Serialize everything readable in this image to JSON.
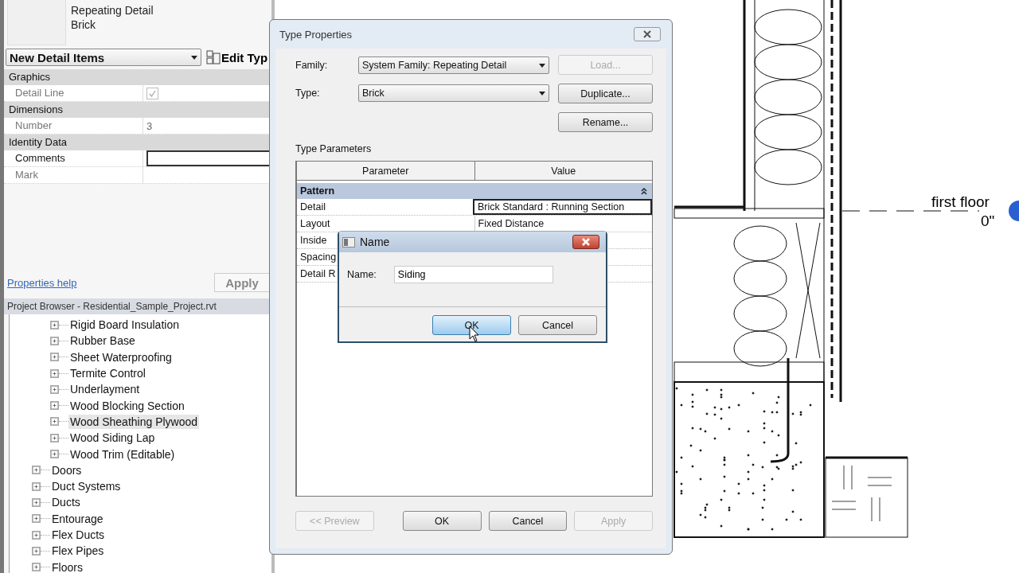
{
  "properties": {
    "type_name": [
      "Repeating Detail",
      "Brick"
    ],
    "selector": "New Detail Items",
    "edit_type": "Edit Typ",
    "groups": [
      {
        "name": "Graphics",
        "rows": [
          {
            "kind": "checkbox",
            "label": "Detail Line",
            "checked": true
          }
        ]
      },
      {
        "name": "Dimensions",
        "rows": [
          {
            "kind": "text",
            "label": "Number",
            "value": "3"
          }
        ]
      },
      {
        "name": "Identity Data",
        "rows": [
          {
            "kind": "field",
            "label": "Comments"
          },
          {
            "kind": "text",
            "label": "Mark"
          }
        ]
      }
    ],
    "help_link": "Properties help",
    "apply": {
      "label": "Apply",
      "disabled": true
    }
  },
  "browser": {
    "title": "Project Browser - Residential_Sample_Project.rvt",
    "tree": [
      {
        "children": [
          {
            "label": "Rigid Board Insulation",
            "selected": false
          },
          {
            "label": "Rubber Base",
            "selected": false
          },
          {
            "label": "Sheet Waterproofing",
            "selected": false
          },
          {
            "label": "Termite Control",
            "selected": false
          },
          {
            "label": "Underlayment",
            "selected": false
          },
          {
            "label": "Wood Blocking Section",
            "selected": false
          },
          {
            "label": "Wood Sheathing Plywood",
            "selected": true
          },
          {
            "label": "Wood Siding Lap",
            "selected": false
          },
          {
            "label": "Wood Trim (Editable)",
            "selected": false
          }
        ]
      },
      {
        "label": "Doors",
        "selected": false
      },
      {
        "label": "Duct Systems",
        "selected": false
      },
      {
        "label": "Ducts",
        "selected": false
      },
      {
        "label": "Entourage",
        "selected": false
      },
      {
        "label": "Flex Ducts",
        "selected": false
      },
      {
        "label": "Flex Pipes",
        "selected": false
      },
      {
        "label": "Floors",
        "selected": false
      }
    ]
  },
  "canvas": {
    "level_name": "first floor",
    "level_elevation": "0\""
  },
  "type_properties": {
    "title": "Type Properties",
    "family": {
      "label": "Family:",
      "value": "System Family: Repeating Detail"
    },
    "type": {
      "label": "Type:",
      "value": "Brick"
    },
    "side_buttons": [
      {
        "label": "Load...",
        "disabled": true
      },
      {
        "label": "Duplicate...",
        "disabled": false
      },
      {
        "label": "Rename...",
        "disabled": false
      }
    ],
    "section_label": "Type Parameters",
    "columns": [
      "Parameter",
      "Value"
    ],
    "group": "Pattern",
    "rows": [
      {
        "parameter": "Detail",
        "value": "Brick Standard : Running Section",
        "selected": true
      },
      {
        "parameter": "Layout",
        "value": "Fixed Distance",
        "selected": false
      },
      {
        "parameter": "Inside",
        "selected": false
      },
      {
        "parameter": "Spacing",
        "selected": false
      },
      {
        "parameter": "Detail R",
        "selected": false
      }
    ],
    "footer_buttons": [
      {
        "label": "<< Preview",
        "disabled": true
      },
      {
        "label": "OK",
        "disabled": false
      },
      {
        "label": "Cancel",
        "disabled": false
      },
      {
        "label": "Apply",
        "disabled": true
      }
    ]
  },
  "name_dialog": {
    "title": "Name",
    "label": "Name:",
    "value": "Siding",
    "buttons": [
      {
        "label": "OK",
        "focused": true
      },
      {
        "label": "Cancel",
        "focused": false
      }
    ]
  }
}
